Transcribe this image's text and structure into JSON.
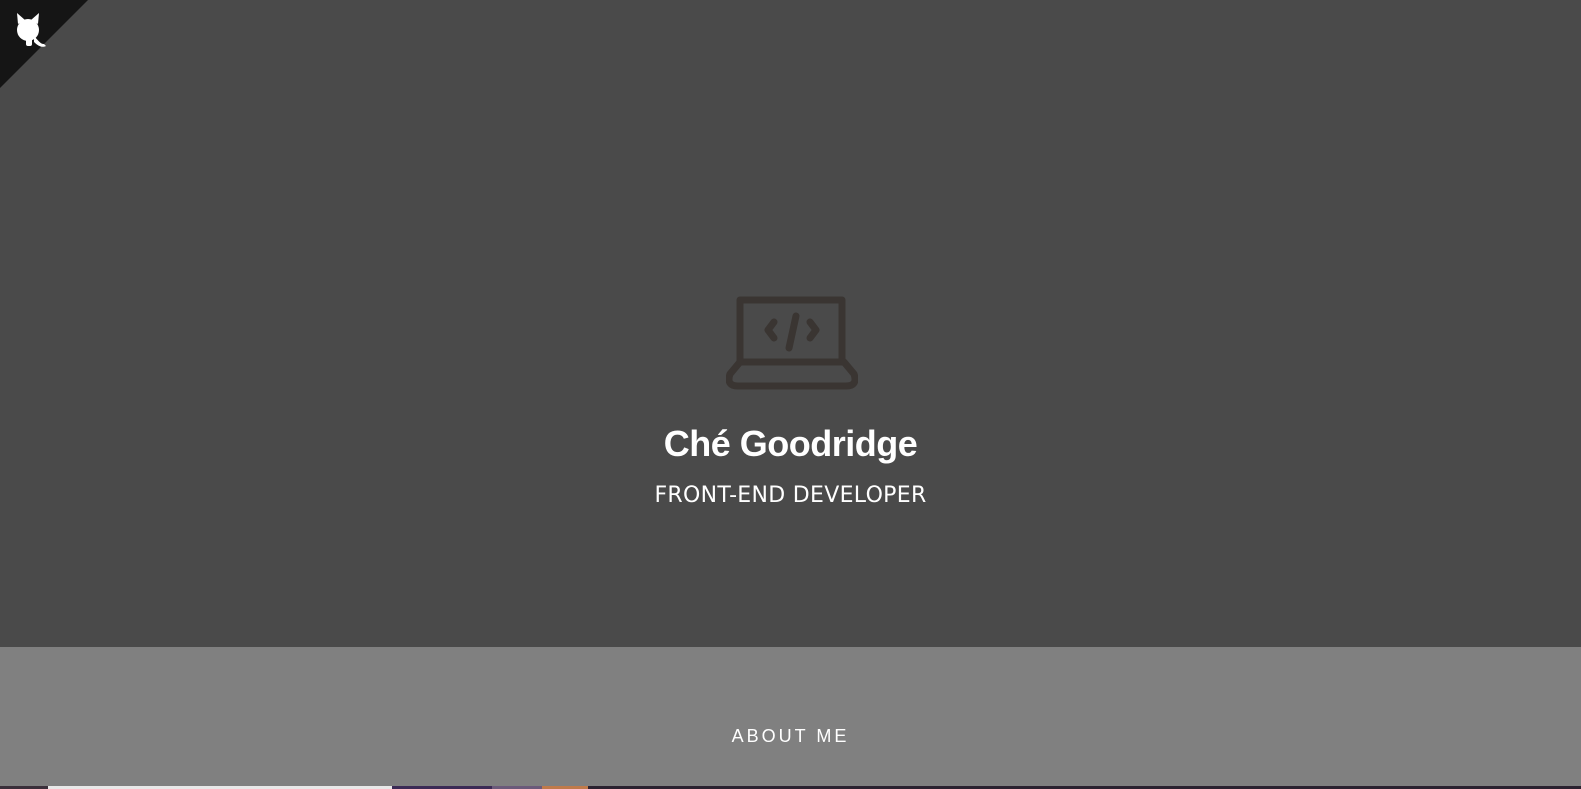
{
  "corner": {
    "icon": "github-octocat-icon",
    "background": "#151515",
    "icon_color": "#ffffff"
  },
  "hero": {
    "background": "#4a4a4a",
    "icon": "laptop-code-icon",
    "icon_color": "#3a3532",
    "name": "Ché Goodridge",
    "role": "FRONT-END DEVELOPER"
  },
  "about": {
    "background": "#808080",
    "title": "ABOUT ME"
  }
}
